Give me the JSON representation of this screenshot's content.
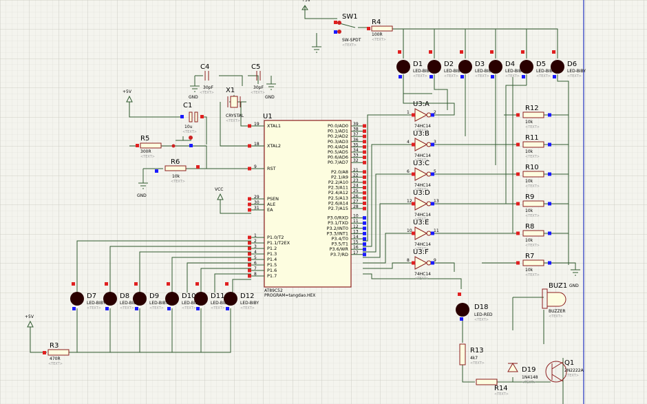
{
  "colors": {
    "background": "#f4f4ee",
    "grid_minor": "#dcdcd4",
    "grid_major": "#c6c6bc",
    "wire": "#2f5a2f",
    "component_outline": "#8b1c1c",
    "component_fill": "#fdfde0",
    "led_body": "#2a0000",
    "pin_blue": "#1a1aff",
    "pin_red": "#e02020",
    "sheet_border": "#2030c0"
  },
  "components": {
    "mcu": {
      "ref": "U1",
      "part": "AT89C52",
      "program": "PROGRAM=tangdao.HEX"
    },
    "mcu_pins_left": [
      {
        "name": "XTAL1",
        "num": "19"
      },
      {
        "name": "XTAL2",
        "num": "18"
      },
      {
        "name": "RST",
        "num": "9"
      },
      {
        "name": "PSEN",
        "num": "29"
      },
      {
        "name": "ALE",
        "num": "30"
      },
      {
        "name": "EA",
        "num": "31"
      },
      {
        "name": "P1.0/T2",
        "num": "1"
      },
      {
        "name": "P1.1/T2EX",
        "num": "2"
      },
      {
        "name": "P1.2",
        "num": "3"
      },
      {
        "name": "P1.3",
        "num": "4"
      },
      {
        "name": "P1.4",
        "num": "5"
      },
      {
        "name": "P1.5",
        "num": "6"
      },
      {
        "name": "P1.6",
        "num": "7"
      },
      {
        "name": "P1.7",
        "num": "8"
      }
    ],
    "mcu_pins_right": [
      {
        "name": "P0.0/AD0",
        "num": "39"
      },
      {
        "name": "P0.1/AD1",
        "num": "38"
      },
      {
        "name": "P0.2/AD2",
        "num": "37"
      },
      {
        "name": "P0.3/AD3",
        "num": "36"
      },
      {
        "name": "P0.4/AD4",
        "num": "35"
      },
      {
        "name": "P0.5/AD5",
        "num": "34"
      },
      {
        "name": "P0.6/AD6",
        "num": "33"
      },
      {
        "name": "P0.7/AD7",
        "num": "32"
      },
      {
        "name": "P2.0/A8",
        "num": "21"
      },
      {
        "name": "P2.1/A9",
        "num": "22"
      },
      {
        "name": "P2.2/A10",
        "num": "23"
      },
      {
        "name": "P2.3/A11",
        "num": "24"
      },
      {
        "name": "P2.4/A12",
        "num": "25"
      },
      {
        "name": "P2.5/A13",
        "num": "26"
      },
      {
        "name": "P2.6/A14",
        "num": "27"
      },
      {
        "name": "P2.7/A15",
        "num": "28"
      },
      {
        "name": "P3.0/RXD",
        "num": "10"
      },
      {
        "name": "P3.1/TXD",
        "num": "11"
      },
      {
        "name": "P3.2/INT0",
        "num": "12"
      },
      {
        "name": "P3.3/INT1",
        "num": "13"
      },
      {
        "name": "P3.4/T0",
        "num": "14"
      },
      {
        "name": "P3.5/T1",
        "num": "15"
      },
      {
        "name": "P3.6/WR",
        "num": "16"
      },
      {
        "name": "P3.7/RD",
        "num": "17"
      }
    ],
    "text_placeholder": "<TEXT>",
    "sw1": {
      "ref": "SW1",
      "part": "SW-SPDT"
    },
    "r4": {
      "ref": "R4",
      "value": "100R"
    },
    "top_leds": [
      {
        "ref": "D1",
        "part": "LED-BIBY"
      },
      {
        "ref": "D2",
        "part": "LED-BIBY"
      },
      {
        "ref": "D3",
        "part": "LED-BIBY"
      },
      {
        "ref": "D4",
        "part": "LED-BIBY"
      },
      {
        "ref": "D5",
        "part": "LED-BIBY"
      },
      {
        "ref": "D6",
        "part": "LED-BIBY"
      }
    ],
    "bottom_leds": [
      {
        "ref": "D7",
        "part": "LED-BIBY"
      },
      {
        "ref": "D8",
        "part": "LED-BIBY"
      },
      {
        "ref": "D9",
        "part": "LED-BIBY"
      },
      {
        "ref": "D10",
        "part": "LED-BIBY"
      },
      {
        "ref": "D11",
        "part": "LED-BIBY"
      },
      {
        "ref": "D12",
        "part": "LED-BIBY"
      }
    ],
    "inverters": [
      {
        "ref": "U3:A",
        "part": "74HC14",
        "in": "1",
        "out": "2"
      },
      {
        "ref": "U3:B",
        "part": "74HC14",
        "in": "4",
        "out": "3"
      },
      {
        "ref": "U3:C",
        "part": "74HC14",
        "in": "6",
        "out": "5"
      },
      {
        "ref": "U3:D",
        "part": "74HC14",
        "in": "12",
        "out": "13"
      },
      {
        "ref": "U3:E",
        "part": "74HC14",
        "in": "10",
        "out": "11"
      },
      {
        "ref": "U3:F",
        "part": "74HC14",
        "in": "8",
        "out": "9"
      }
    ],
    "pullups": [
      {
        "ref": "R12",
        "value": "10k"
      },
      {
        "ref": "R11",
        "value": "10k"
      },
      {
        "ref": "R10",
        "value": "10k"
      },
      {
        "ref": "R9",
        "value": "10k"
      },
      {
        "ref": "R8",
        "value": "10k"
      },
      {
        "ref": "R7",
        "value": "10k"
      }
    ],
    "c4": {
      "ref": "C4",
      "value": "30pF"
    },
    "c5": {
      "ref": "C5",
      "value": "30pF"
    },
    "x1": {
      "ref": "X1",
      "part": "CRYSTAL"
    },
    "c1": {
      "ref": "C1",
      "value": "10u"
    },
    "r5": {
      "ref": "R5",
      "value": "300R"
    },
    "r6": {
      "ref": "R6",
      "value": "10k"
    },
    "r3": {
      "ref": "R3",
      "value": "470R"
    },
    "d18": {
      "ref": "D18",
      "part": "LED-RED"
    },
    "buz1": {
      "ref": "BUZ1",
      "part": "BUZZER"
    },
    "r13": {
      "ref": "R13",
      "value": "4k7"
    },
    "r14": {
      "ref": "R14"
    },
    "d19": {
      "ref": "D19",
      "part": "1N4148"
    },
    "q1": {
      "ref": "Q1",
      "part": "2N2222A"
    },
    "power": {
      "vcc": "VCC",
      "plus5v": "+5V",
      "gnd": "GND"
    }
  }
}
